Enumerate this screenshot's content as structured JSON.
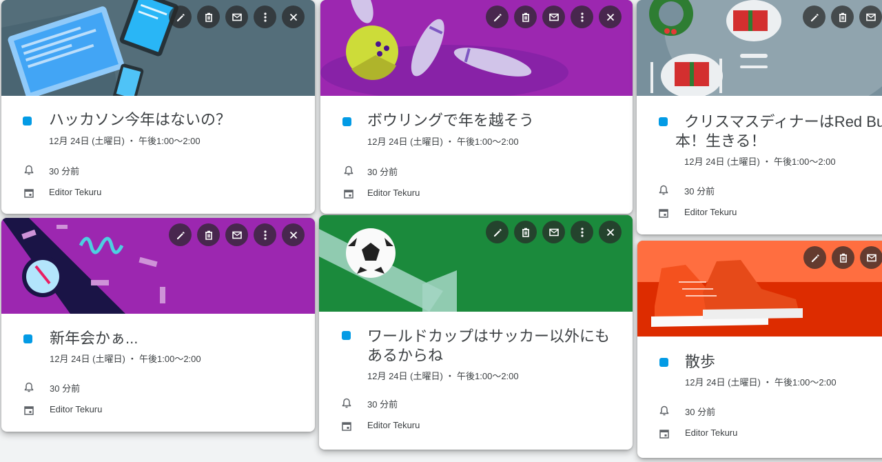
{
  "colors": {
    "dot": "#039be5",
    "toolbar_btn": "#3a3a3a"
  },
  "toolbar_icons": [
    "edit-icon",
    "delete-icon",
    "email-icon",
    "more-options-icon",
    "close-icon"
  ],
  "cards": [
    {
      "title": "ハッカソン今年はないの？",
      "title2": "",
      "when": "12月 24日 (土曜日) ・ 午後1:00～2:00",
      "reminder": "30 分前",
      "calendar": "Editor Tekuru"
    },
    {
      "title": "ボウリングで年を越そう",
      "title2": "",
      "when": "12月 24日 (土曜日) ・ 午後1:00～2:00",
      "reminder": "30 分前",
      "calendar": "Editor Tekuru"
    },
    {
      "title": "クリスマスディナーはRed Bu",
      "title2": "本！生きる！",
      "when": "12月 24日 (土曜日) ・ 午後1:00～2:00",
      "reminder": "30 分前",
      "calendar": "Editor Tekuru"
    },
    {
      "title": "新年会かぁ...",
      "title2": "",
      "when": "12月 24日 (土曜日) ・ 午後1:00～2:00",
      "reminder": "30 分前",
      "calendar": "Editor Tekuru"
    },
    {
      "title": "ワールドカップはサッカー以外にも",
      "title2": "あるからね",
      "when": "12月 24日 (土曜日) ・ 午後1:00～2:00",
      "reminder": "30 分前",
      "calendar": "Editor Tekuru"
    },
    {
      "title": "散歩",
      "title2": "",
      "when": "12月 24日 (土曜日) ・ 午後1:00～2:00",
      "reminder": "30 分前",
      "calendar": "Editor Tekuru"
    }
  ]
}
